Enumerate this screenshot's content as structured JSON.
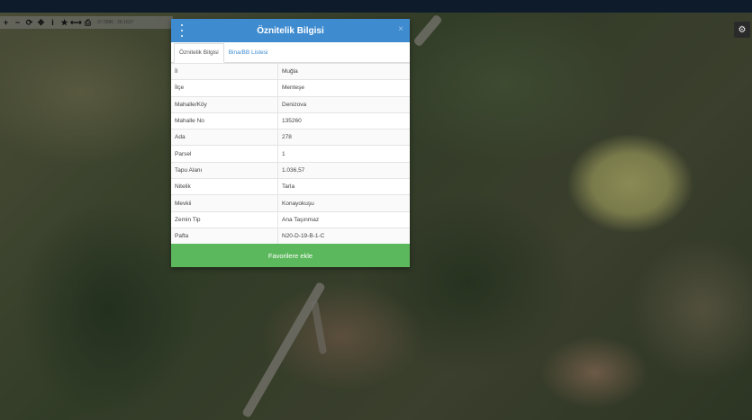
{
  "toolbar": {
    "icons": [
      "zoom-in-icon",
      "zoom-out-icon",
      "refresh-icon",
      "pan-icon",
      "info-icon",
      "star-icon",
      "measure-icon",
      "print-icon"
    ],
    "glyphs": [
      "+",
      "−",
      "⟳",
      "✥",
      "i",
      "★",
      "⟷",
      "⎙"
    ],
    "coordinates": "37.0586 : 28.1637"
  },
  "settings_glyph": "⚙",
  "dialog": {
    "title": "Öznitelik Bilgisi",
    "close_glyph": "×",
    "tabs": [
      {
        "label": "Öznitelik Bilgisi",
        "active": true
      },
      {
        "label": "Bina/BB Listesi",
        "active": false
      }
    ],
    "rows": [
      {
        "key": "İl",
        "value": "Muğla"
      },
      {
        "key": "İlçe",
        "value": "Menteşe"
      },
      {
        "key": "Mahalle/Köy",
        "value": "Denizova"
      },
      {
        "key": "Mahalle No",
        "value": "135260"
      },
      {
        "key": "Ada",
        "value": "278"
      },
      {
        "key": "Parsel",
        "value": "1"
      },
      {
        "key": "Tapu Alanı",
        "value": "1.036,57"
      },
      {
        "key": "Nitelik",
        "value": "Tarla"
      },
      {
        "key": "Mevkii",
        "value": "Konayokuşu"
      },
      {
        "key": "Zemin Tip",
        "value": "Ana Taşınmaz"
      },
      {
        "key": "Pafta",
        "value": "N20-D-19-B-1-C"
      }
    ],
    "favorite_button": "Favorilere ekle"
  },
  "colors": {
    "header": "#3e8bd0",
    "favorite": "#5cb85c",
    "topbar": "#0d1b2a"
  }
}
